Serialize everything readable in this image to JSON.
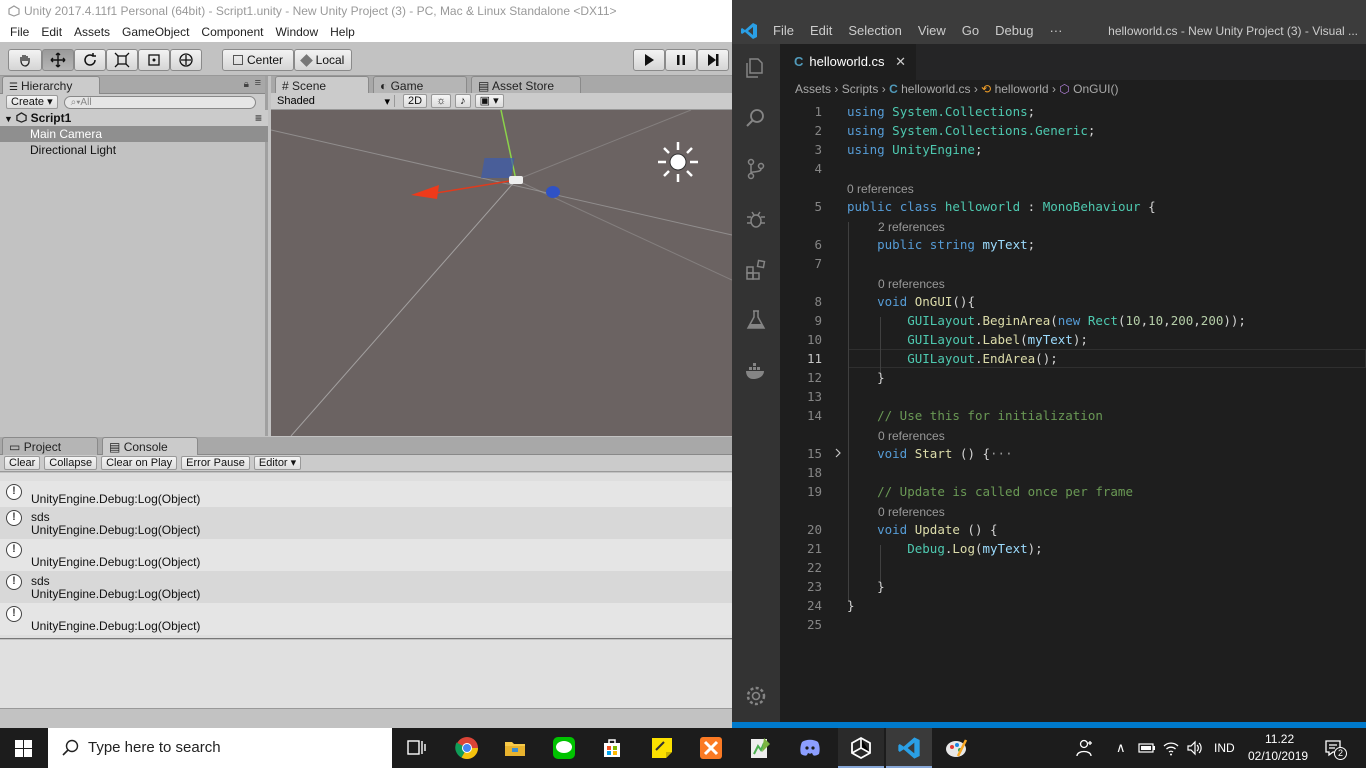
{
  "unity": {
    "title": "Unity 2017.4.11f1 Personal (64bit) - Script1.unity - New Unity Project (3) - PC, Mac & Linux Standalone <DX11>",
    "menu": [
      "File",
      "Edit",
      "Assets",
      "GameObject",
      "Component",
      "Window",
      "Help"
    ],
    "toolbar": {
      "center_label": "Center",
      "local_label": "Local"
    },
    "hierarchy": {
      "tab_label": "Hierarchy",
      "create_label": "Create",
      "search_placeholder": "All",
      "scene_name": "Script1",
      "items": [
        "Main Camera",
        "Directional Light"
      ]
    },
    "scene": {
      "tabs": [
        "Scene",
        "Game",
        "Asset Store"
      ],
      "shading": "Shaded",
      "mode_2d": "2D"
    },
    "bottom": {
      "tabs": [
        "Project",
        "Console"
      ],
      "buttons": [
        "Clear",
        "Collapse",
        "Clear on Play",
        "Error Pause",
        "Editor"
      ],
      "entries": [
        {
          "line1": "",
          "line2": "UnityEngine.Debug:Log(Object)"
        },
        {
          "line1": "sds",
          "line2": "UnityEngine.Debug:Log(Object)"
        },
        {
          "line1": "",
          "line2": "UnityEngine.Debug:Log(Object)"
        },
        {
          "line1": "sds",
          "line2": "UnityEngine.Debug:Log(Object)"
        },
        {
          "line1": "",
          "line2": "UnityEngine.Debug:Log(Object)"
        }
      ]
    }
  },
  "vscode": {
    "menu": [
      "File",
      "Edit",
      "Selection",
      "View",
      "Go",
      "Debug",
      "···"
    ],
    "window_title": "helloworld.cs - New Unity Project (3) - Visual ...",
    "tab_label": "helloworld.cs",
    "breadcrumbs": [
      "Assets",
      "Scripts",
      "helloworld.cs",
      "helloworld",
      "OnGUI()"
    ],
    "line_numbers": [
      "1",
      "2",
      "3",
      "4",
      "5",
      "6",
      "7",
      "8",
      "9",
      "10",
      "11",
      "12",
      "13",
      "14",
      "15",
      "18",
      "19",
      "20",
      "21",
      "22",
      "23",
      "24",
      "25"
    ],
    "lens": {
      "l5": "0 references",
      "l6": "2 references",
      "l8": "0 references",
      "l15": "0 references",
      "l20": "0 references"
    }
  },
  "taskbar": {
    "search_placeholder": "Type here to search",
    "language": "IND",
    "time": "11.22",
    "date": "02/10/2019",
    "notifications": "2"
  }
}
